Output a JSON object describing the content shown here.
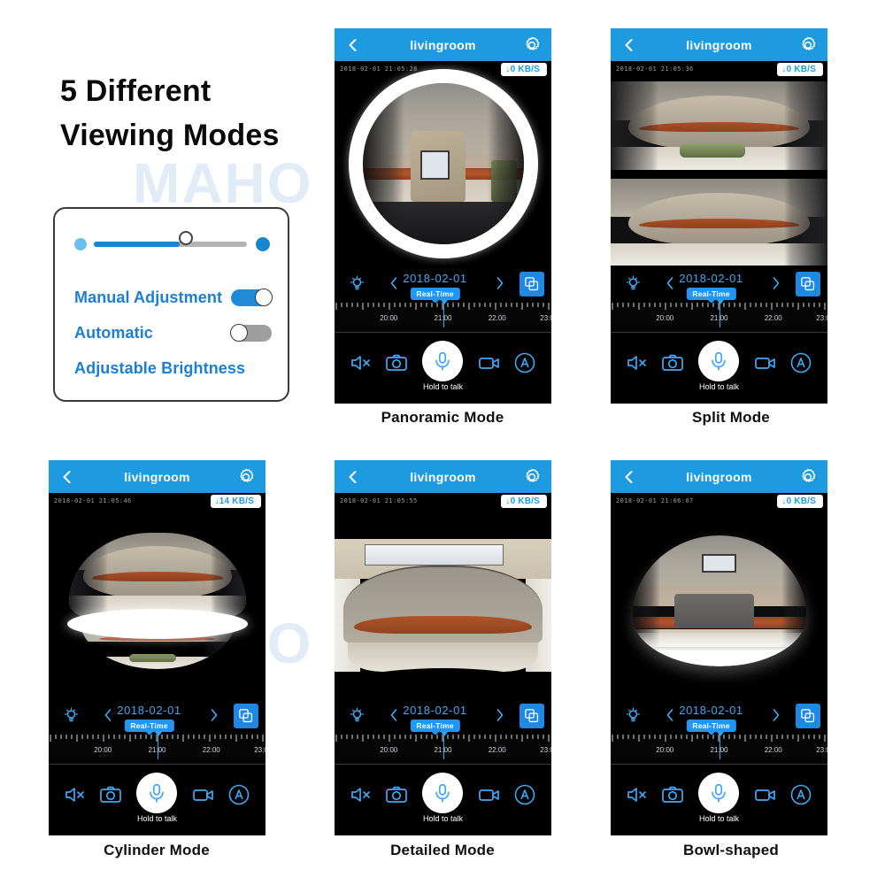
{
  "headline": {
    "line1": "5 Different",
    "line2": "Viewing Modes"
  },
  "watermark": {
    "text": "MAHO"
  },
  "settings_card": {
    "slider": {
      "name": "brightness-slider",
      "value_percent": 54,
      "track_color": "#b3b3b3",
      "fill_color": "#1686cf",
      "left_dot_color": "#6cc0ec",
      "right_dot_color": "#1686cf"
    },
    "rows": [
      {
        "label": "Manual Adjustment",
        "toggle": "on",
        "toggle_color": "#2089d8"
      },
      {
        "label": "Automatic",
        "toggle": "off",
        "toggle_color": "#9e9e9e"
      },
      {
        "label": "Adjustable Brightness",
        "toggle": "none"
      }
    ],
    "label_color": "#1b7fd4"
  },
  "common": {
    "header_title": "livingroom",
    "header_color": "#1e9be0",
    "back_icon": "chevron-left-icon",
    "gear_icon": "gear-icon",
    "date": "2018-02-01",
    "realtime_badge": "Real-Time",
    "accent_blue": "#3fa9f5",
    "timeline_labels": [
      "20:00",
      "21:00",
      "22:00",
      "23:0"
    ],
    "controls": {
      "mute_icon": "speaker-muted-icon",
      "snapshot_icon": "camera-icon",
      "mic_icon": "microphone-icon",
      "mic_label": "Hold to talk",
      "record_icon": "video-camera-icon",
      "auto_icon": "auto-circle-icon"
    },
    "multiview_icon": "multi-window-icon",
    "bulb_icon": "lightbulb-icon",
    "prev_icon": "chevron-left-icon",
    "next_icon": "chevron-right-icon"
  },
  "phones": [
    {
      "id": "panoramic",
      "caption": "Panoramic Mode",
      "timestamp": "2018-02-01 21:05:28",
      "bitrate": "0 KB/S",
      "bitrate_prefix": "↓"
    },
    {
      "id": "split",
      "caption": "Split Mode",
      "timestamp": "2018-02-01 21:05:36",
      "bitrate": "0 KB/S",
      "bitrate_prefix": "↓"
    },
    {
      "id": "cylinder",
      "caption": "Cylinder Mode",
      "timestamp": "2018-02-01 21:05:46",
      "bitrate": "14 KB/S",
      "bitrate_prefix": "↓"
    },
    {
      "id": "detailed",
      "caption": "Detailed Mode",
      "timestamp": "2018-02-01 21:05:55",
      "bitrate": "0 KB/S",
      "bitrate_prefix": "↓"
    },
    {
      "id": "bowl",
      "caption": "Bowl-shaped",
      "timestamp": "2018-02-01 21:06:07",
      "bitrate": "0 KB/S",
      "bitrate_prefix": "↓"
    }
  ]
}
